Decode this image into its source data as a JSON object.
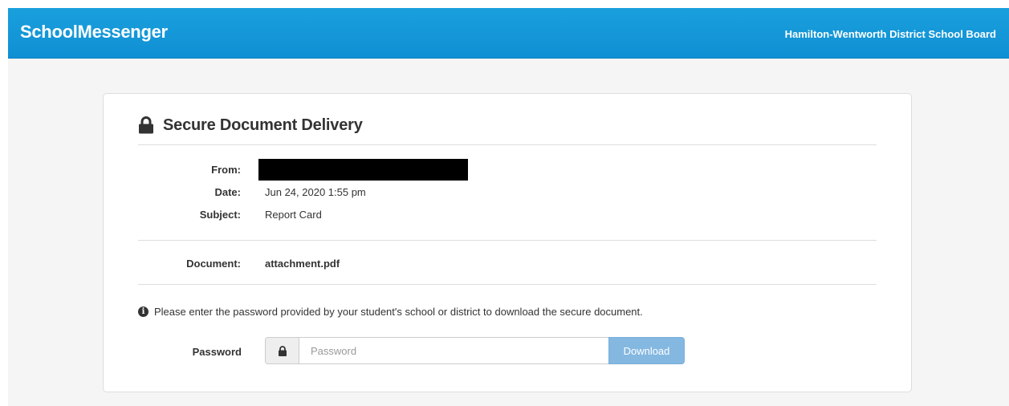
{
  "header": {
    "brand": "SchoolMessenger",
    "district": "Hamilton-Wentworth District School Board"
  },
  "card": {
    "title": "Secure Document Delivery",
    "fields": [
      {
        "label": "From:",
        "value": ""
      },
      {
        "label": "Date:",
        "value": "Jun 24, 2020 1:55 pm"
      },
      {
        "label": "Subject:",
        "value": "Report Card"
      }
    ],
    "document": {
      "label": "Document:",
      "value": "attachment.pdf"
    },
    "info": {
      "icon": "info-circle-icon",
      "text": "Please enter the password provided by your student's school or district to download the secure document."
    },
    "password": {
      "label": "Password",
      "icon": "lock-icon",
      "placeholder": "Password",
      "value": "",
      "button_label": "Download"
    }
  },
  "colors": {
    "header_bg": "#1198da",
    "page_bg": "#f5f5f5",
    "download_button": "#84b8e1"
  }
}
